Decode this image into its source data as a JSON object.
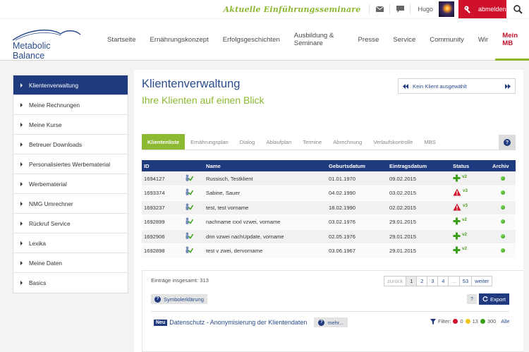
{
  "topbar": {
    "tagline": "Aktuelle Einführungsseminare",
    "icons": [
      "mail-icon",
      "chat-icon",
      "search-icon",
      "key-icon"
    ],
    "user_name": "Hugo",
    "logout_label": "abmelden",
    "accent_color": "#d0112b"
  },
  "header": {
    "logo_text": "Metabolic Balance",
    "nav": [
      {
        "label": "Startseite"
      },
      {
        "label": "Ernährungskonzept"
      },
      {
        "label": "Erfolgsgeschichten"
      },
      {
        "label": "Ausbildung & Seminare"
      },
      {
        "label": "Presse"
      },
      {
        "label": "Service"
      },
      {
        "label": "Community"
      },
      {
        "label": "Wir"
      },
      {
        "label": "Mein MB"
      }
    ],
    "active_nav": "Mein MB"
  },
  "sidebar": {
    "items": [
      {
        "label": "Klientenverwaltung"
      },
      {
        "label": "Meine Rechnungen"
      },
      {
        "label": "Meine Kurse"
      },
      {
        "label": "Betreuer Downloads"
      },
      {
        "label": "Personalisiertes Werbematerial"
      },
      {
        "label": "Werbematerial"
      },
      {
        "label": "NMG Umrechner"
      },
      {
        "label": "Rückruf Service"
      },
      {
        "label": "Lexika"
      },
      {
        "label": "Meine Daten"
      },
      {
        "label": "Basics"
      }
    ],
    "active": "Klientenverwaltung"
  },
  "main": {
    "title": "Klientenverwaltung",
    "subtitle": "Ihre Klienten auf einen Blick",
    "client_selector": "Kein Klient ausgewählt",
    "tabs": [
      {
        "label": "Klientenliste"
      },
      {
        "label": "Ernährungsplan"
      },
      {
        "label": "Dialog"
      },
      {
        "label": "Ablaufplan"
      },
      {
        "label": "Termine"
      },
      {
        "label": "Abrechnung"
      },
      {
        "label": "Verlaufskontrolle"
      },
      {
        "label": "MBS"
      }
    ],
    "active_tab": "Klientenliste",
    "help_label": "?",
    "table": {
      "columns": [
        "ID",
        "",
        "Name",
        "Geburtsdatum",
        "Eintragsdatum",
        "Status",
        "Archiv"
      ],
      "rows": [
        {
          "id": "1694127",
          "name": "Russisch, Testklient",
          "birth": "01.01.1970",
          "entry": "09.02.2015",
          "status_icon": "add-green-icon",
          "status_version": "v2"
        },
        {
          "id": "1693374",
          "name": "Sabine, Sauer",
          "birth": "04.02.1990",
          "entry": "03.02.2015",
          "status_icon": "alert-red-icon",
          "status_version": "v3"
        },
        {
          "id": "1693237",
          "name": "test, test vorname",
          "birth": "18.02.1990",
          "entry": "02.02.2015",
          "status_icon": "alert-red-icon",
          "status_version": "v3"
        },
        {
          "id": "1692899",
          "name": "nachname cxxl vzwei, vorname",
          "birth": "03.02.1976",
          "entry": "29.01.2015",
          "status_icon": "add-green-icon",
          "status_version": "v2"
        },
        {
          "id": "1692906",
          "name": "dnn vzwei nachUpdate, vorname",
          "birth": "02.05.1976",
          "entry": "29.01.2015",
          "status_icon": "add-green-icon",
          "status_version": "v2"
        },
        {
          "id": "1692898",
          "name": "test v zwei, dervorname",
          "birth": "03.06.1967",
          "entry": "29.01.2015",
          "status_icon": "add-green-icon",
          "status_version": "v2"
        }
      ]
    },
    "footer": {
      "total_label": "Einträge insgesamt: 313",
      "pager": [
        {
          "label": "zurück",
          "state": "disabled"
        },
        {
          "label": "1",
          "state": "active"
        },
        {
          "label": "2",
          "state": ""
        },
        {
          "label": "3",
          "state": ""
        },
        {
          "label": "4",
          "state": ""
        },
        {
          "label": "...",
          "state": "disabled"
        },
        {
          "label": "53",
          "state": ""
        },
        {
          "label": "weiter",
          "state": ""
        }
      ],
      "legend_label": "Symbolerklärung",
      "small_help": "?",
      "export_label": "Export",
      "news_badge": "Neu",
      "news_title": "Datenschutz - Anonymisierung der Klientendaten",
      "more_label": "mehr...",
      "filter_label": "Filter:",
      "filter_counts": [
        {
          "count": "0",
          "color": "#d0112b"
        },
        {
          "count": "13",
          "color": "#f2c51a"
        },
        {
          "count": "300",
          "color": "#3aa01a"
        }
      ],
      "filter_all": "Alle"
    }
  },
  "colors": {
    "brand_blue": "#1f3a7e",
    "brand_green": "#8cb832",
    "brand_red": "#c0122c"
  }
}
